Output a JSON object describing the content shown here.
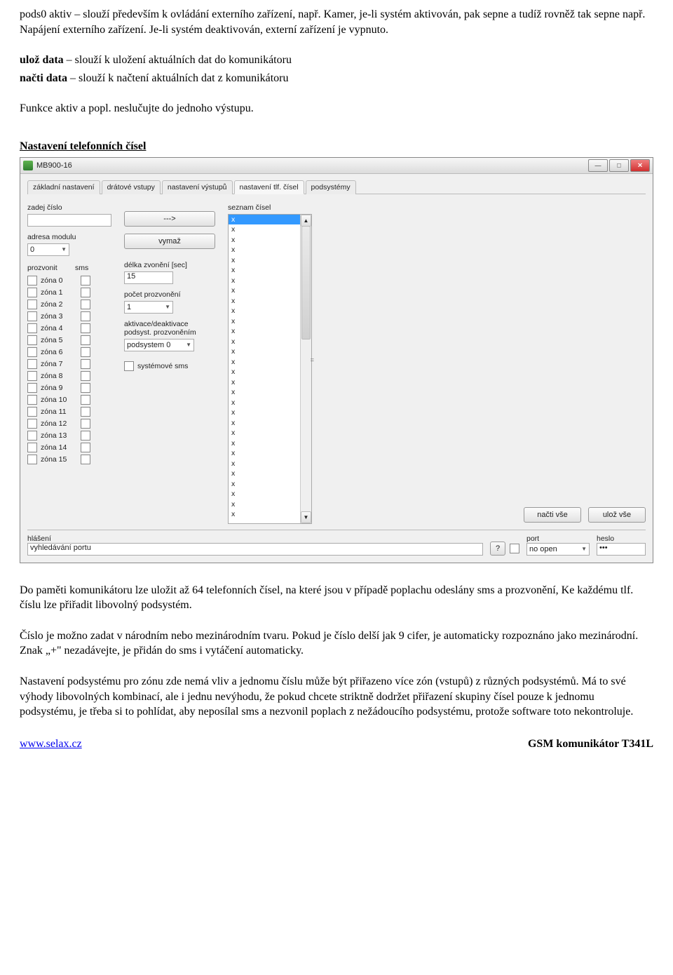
{
  "doc": {
    "p1": "pods0 aktiv – slouží především k ovládání externího zařízení, např. Kamer, je-li systém aktivován, pak sepne a tudíž rovněž tak sepne např. Napájení externího zařízení. Je-li systém deaktivován, externí zařízení je vypnuto.",
    "p2a": "ulož data",
    "p2b": " – slouží k uložení aktuálních dat do komunikátoru",
    "p3a": "načti data",
    "p3b": " – slouží k načtení aktuálních dat z komunikátoru",
    "p4": "Funkce aktiv a popl. neslučujte do jednoho výstupu.",
    "h1": "Nastavení telefonních čísel",
    "p5": "Do paměti komunikátoru lze uložit až 64 telefonních čísel, na které jsou v případě poplachu odeslány sms a prozvonění, Ke každému tlf. číslu lze přiřadit libovolný podsystém.",
    "p6": "Číslo je možno zadat v národním nebo mezinárodním tvaru. Pokud je číslo delší jak 9 cifer, je automaticky rozpoznáno jako mezinárodní. Znak „+\" nezadávejte, je přidán do sms i vytáčení automaticky.",
    "p7": "Nastavení podsystému pro zónu zde nemá vliv a jednomu číslu může být přiřazeno více zón (vstupů) z různých podsystémů. Má to své výhody libovolných kombinací, ale i jednu nevýhodu, že pokud chcete striktně dodržet přiřazení skupiny čísel pouze k jednomu podsystému, je třeba si to pohlídat, aby neposílal sms a nezvonil poplach z nežádoucího podsystému, protože software toto nekontroluje."
  },
  "footer": {
    "left": "www.selax.cz",
    "right": "GSM komunikátor T341L"
  },
  "win": {
    "title": "MB900-16",
    "tabs": [
      "základní nastavení",
      "drátové vstupy",
      "nastavení výstupů",
      "nastavení tlf. čísel",
      "podsystémy"
    ],
    "left": {
      "lbl_zadej": "zadej číslo",
      "lbl_adresa": "adresa modulu",
      "adresa_val": "0",
      "hdr_prozvonit": "prozvonit",
      "hdr_sms": "sms",
      "zones": [
        "zóna 0",
        "zóna 1",
        "zóna 2",
        "zóna 3",
        "zóna 4",
        "zóna 5",
        "zóna 6",
        "zóna 7",
        "zóna 8",
        "zóna 9",
        "zóna 10",
        "zóna 11",
        "zóna 12",
        "zóna 13",
        "zóna 14",
        "zóna 15"
      ]
    },
    "mid": {
      "btn_arrow": "--->",
      "btn_vymaz": "vymaž",
      "lbl_delka": "délka zvonění [sec]",
      "val_delka": "15",
      "lbl_pocet": "počet prozvonění",
      "val_pocet": "1",
      "lbl_akt1": "aktivace/deaktivace",
      "lbl_akt2": "podsyst. prozvoněním",
      "val_podsyst": "podsystem 0",
      "chk_sys": "systémové sms"
    },
    "list": {
      "lbl": "seznam čísel",
      "items": [
        "x",
        "x",
        "x",
        "x",
        "x",
        "x",
        "x",
        "x",
        "x",
        "x",
        "x",
        "x",
        "x",
        "x",
        "x",
        "x",
        "x",
        "x",
        "x",
        "x",
        "x",
        "x",
        "x",
        "x",
        "x",
        "x",
        "x",
        "x",
        "x",
        "x"
      ]
    },
    "btns": {
      "nacti": "načti vše",
      "uloz": "ulož vše"
    },
    "status": {
      "lbl_hlaseni": "hlášení",
      "val_hlaseni": "vyhledávání portu",
      "lbl_port": "port",
      "val_port": "no open",
      "lbl_heslo": "heslo",
      "val_heslo": "•••"
    }
  }
}
